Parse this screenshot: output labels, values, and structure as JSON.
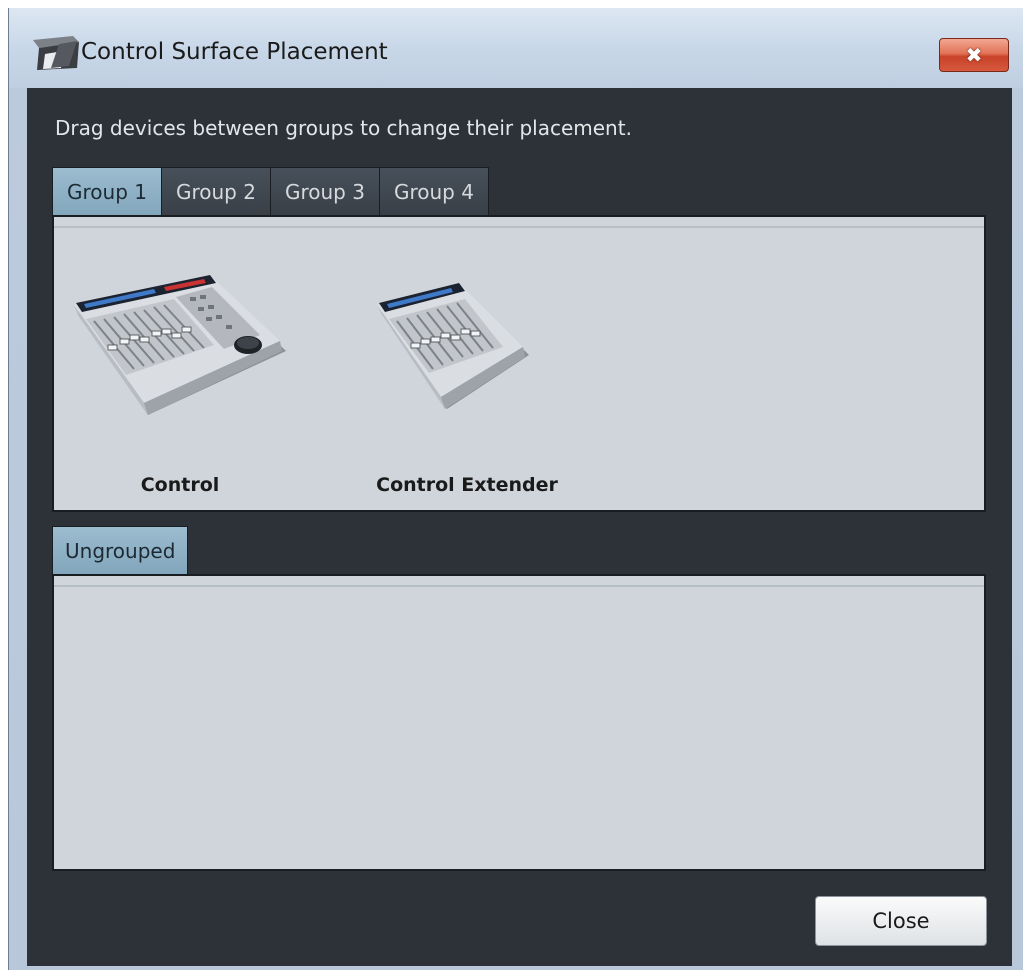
{
  "window": {
    "title": "Control Surface Placement",
    "close_label": "✖"
  },
  "instructions": "Drag devices between groups to change their placement.",
  "group_tabs": [
    {
      "label": "Group 1",
      "active": true
    },
    {
      "label": "Group 2",
      "active": false
    },
    {
      "label": "Group 3",
      "active": false
    },
    {
      "label": "Group 4",
      "active": false
    }
  ],
  "group_devices": [
    {
      "label": "Control",
      "icon": "control-surface-icon"
    },
    {
      "label": "Control Extender",
      "icon": "control-extender-icon"
    }
  ],
  "ungrouped": {
    "tab_label": "Ungrouped",
    "devices": []
  },
  "footer": {
    "close_button_label": "Close"
  },
  "colors": {
    "client_background": "#2c3238",
    "panel_background": "#cfd5db",
    "active_tab": "#9cbccf",
    "inactive_tab": "#3f464e",
    "close_x_red": "#d6583c"
  }
}
